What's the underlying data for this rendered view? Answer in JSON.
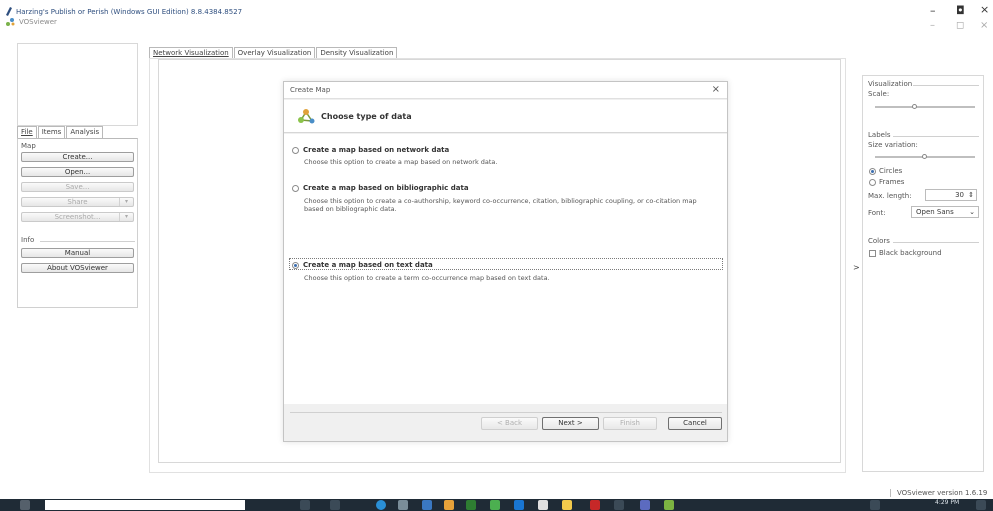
{
  "outer_window": {
    "title": "Harzing's Publish or Perish (Windows GUI Edition) 8.8.4384.8527",
    "controls": [
      "–",
      "◘",
      "×"
    ]
  },
  "app_window": {
    "title": "VOSviewer",
    "controls": [
      "–",
      "◻",
      "×"
    ]
  },
  "left_tabs": [
    "File",
    "Items",
    "Analysis"
  ],
  "left_panel": {
    "map_label": "Map",
    "buttons": {
      "create": "Create...",
      "open": "Open...",
      "save": "Save...",
      "share": "Share",
      "screenshot": "Screenshot..."
    },
    "info_label": "Info",
    "info_buttons": {
      "manual": "Manual",
      "about": "About VOSviewer"
    }
  },
  "main_tabs": [
    "Network Visualization",
    "Overlay Visualization",
    "Density Visualization"
  ],
  "dialog": {
    "title": "Create Map",
    "close": "×",
    "heading": "Choose type of data",
    "options": [
      {
        "label": "Create a map based on network data",
        "desc": "Choose this option to create a map based on network data.",
        "selected": false
      },
      {
        "label": "Create a map based on bibliographic data",
        "desc": "Choose this option to create a co-authorship, keyword co-occurrence, citation, bibliographic coupling, or co-citation map based on bibliographic data.",
        "selected": false
      },
      {
        "label": "Create a map based on text data",
        "desc": "Choose this option to create a term co-occurrence map based on text data.",
        "selected": true
      }
    ],
    "buttons": {
      "back": "< Back",
      "next": "Next >",
      "finish": "Finish",
      "cancel": "Cancel"
    }
  },
  "right_panel": {
    "visualization_label": "Visualization",
    "scale_label": "Scale:",
    "scale_level": 0.4,
    "labels_label": "Labels",
    "size_variation_label": "Size variation:",
    "size_variation_level": 0.5,
    "circles_label": "Circles",
    "frames_label": "Frames",
    "max_length_label": "Max. length:",
    "max_length_value": "30",
    "font_label": "Font:",
    "font_value": "Open Sans",
    "colors_label": "Colors",
    "black_background_label": "Black background"
  },
  "expander": ">",
  "status_bar": {
    "version": "VOSviewer version 1.6.19"
  },
  "taskbar": {
    "time": "4:29 PM"
  },
  "colors": {
    "accent": "#3d6fb0",
    "taskbar": "#1f2b36"
  }
}
